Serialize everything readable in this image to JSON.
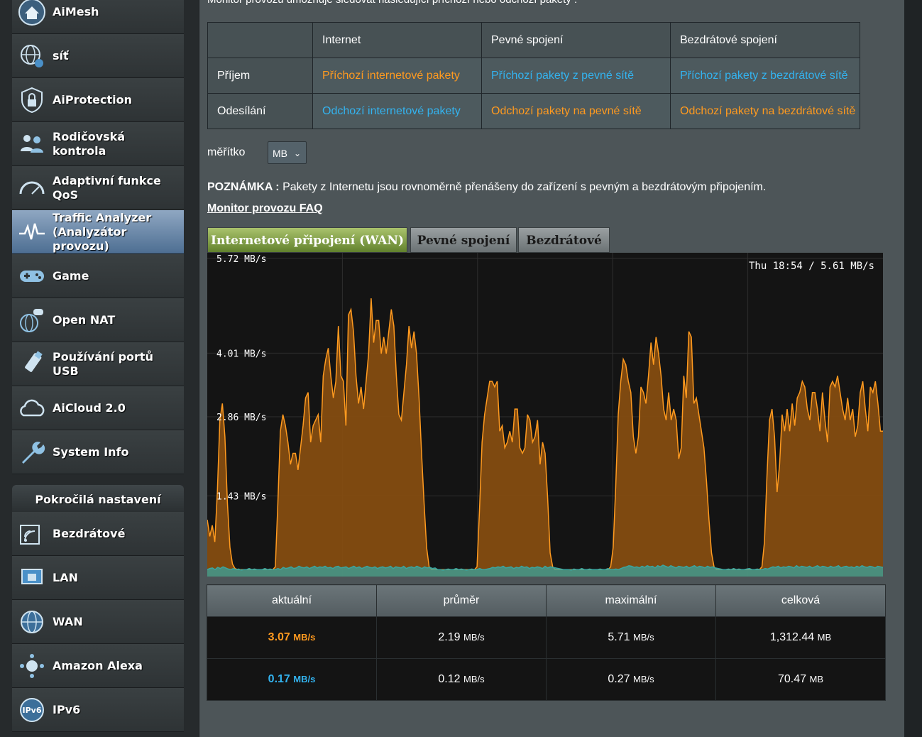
{
  "menu": {
    "items": [
      {
        "label": "AiMesh",
        "icon": "mesh-house-icon"
      },
      {
        "label": "síť",
        "icon": "network-globe-icon"
      },
      {
        "label": "AiProtection",
        "icon": "lock-shield-icon"
      },
      {
        "label": "Rodičovská kontrola",
        "icon": "parental-people-icon"
      },
      {
        "label": "Adaptivní funkce QoS",
        "icon": "speedometer-icon"
      },
      {
        "label": "Traffic Analyzer (Analyzátor provozu)",
        "icon": "pulse-icon"
      },
      {
        "label": "Game",
        "icon": "gamepad-icon"
      },
      {
        "label": "Open NAT",
        "icon": "nat-globe-icon"
      },
      {
        "label": "Používání portů USB",
        "icon": "usb-icon"
      },
      {
        "label": "AiCloud 2.0",
        "icon": "cloud-icon"
      },
      {
        "label": "System Info",
        "icon": "wrench-icon"
      }
    ],
    "advanced_header": "Pokročilá nastavení",
    "advanced_items": [
      {
        "label": "Bezdrátové",
        "icon": "wireless-icon"
      },
      {
        "label": "LAN",
        "icon": "lan-icon"
      },
      {
        "label": "WAN",
        "icon": "wan-globe-icon"
      },
      {
        "label": "Amazon Alexa",
        "icon": "alexa-icon"
      },
      {
        "label": "IPv6",
        "icon": "ipv6-icon"
      }
    ]
  },
  "main": {
    "intro": "Monitor provozu umožňuje sledovat následující příchozí nebo odchozí pakety :",
    "packet_table": {
      "headers": [
        "Internet",
        "Pevné spojení",
        "Bezdrátové spojení"
      ],
      "rows": [
        {
          "label": "Příjem",
          "cells": [
            {
              "text": "Příchozí internetové pakety",
              "color": "orange"
            },
            {
              "text": "Příchozí pakety z pevné sítě",
              "color": "blue"
            },
            {
              "text": "Příchozí pakety z bezdrátové sítě",
              "color": "blue"
            }
          ]
        },
        {
          "label": "Odesílání",
          "cells": [
            {
              "text": "Odchozí internetové pakety",
              "color": "blue"
            },
            {
              "text": "Odchozí pakety na pevné sítě",
              "color": "orange"
            },
            {
              "text": "Odchozí pakety na bezdrátové sítě",
              "color": "orange"
            }
          ]
        }
      ]
    },
    "scale_label": "měřítko",
    "scale_value": "MB",
    "note_label": "POZNÁMKA :",
    "note_text": " Pakety z Internetu jsou rovnoměrně přenášeny do zařízení s pevným a bezdrátovým připojením.",
    "faq_link": "Monitor provozu FAQ",
    "tabs": [
      "Internetové připojení (WAN)",
      "Pevné spojení",
      "Bezdrátové"
    ],
    "stats": {
      "headers": [
        "aktuální",
        "průměr",
        "maximální",
        "celková"
      ],
      "rows": [
        {
          "values": [
            "3.07",
            "2.19",
            "5.71",
            "1,312.44"
          ],
          "units": [
            "MB/s",
            "MB/s",
            "MB/s",
            "MB"
          ]
        },
        {
          "values": [
            "0.17",
            "0.12",
            "0.27",
            "70.47"
          ],
          "units": [
            "MB/s",
            "MB/s",
            "MB/s",
            "MB"
          ]
        }
      ]
    }
  },
  "chart_data": {
    "type": "area",
    "tick_labels": [
      "5.72 MB/s",
      "4.01 MB/s",
      "2.86 MB/s",
      "1.43 MB/s"
    ],
    "tick_values": [
      5.72,
      4.01,
      2.86,
      1.43
    ],
    "ylim": [
      0,
      5.72
    ],
    "status_text": "Thu 18:54 / 5.61 MB/s",
    "colors": {
      "rx": "#ff9a1f",
      "rx_fill": "#8a4f10",
      "tx": "#3aa6a0",
      "grid": "#2e2e2e"
    },
    "series": [
      {
        "values": [
          1.0,
          0.7,
          0.9,
          0.6,
          1.5,
          2.8,
          3.1,
          2.5,
          1.3,
          0.5,
          0.2,
          0.12,
          0.1,
          0.1,
          0.1,
          0.1,
          0.1,
          0.1,
          0.1,
          0.1,
          0.1,
          0.1,
          0.1,
          0.1,
          0.1,
          0.1,
          0.1,
          0.15,
          1.3,
          2.6,
          2.9,
          2.7,
          2.4,
          2.0,
          2.2,
          2.2,
          1.9,
          2.3,
          2.7,
          3.2,
          3.3,
          2.4,
          2.7,
          2.8,
          2.9,
          2.4,
          3.6,
          3.9,
          4.1,
          3.6,
          3.2,
          3.5,
          4.5,
          3.6,
          3.5,
          2.7,
          4.7,
          4.8,
          4.4,
          3.6,
          3.1,
          3.4,
          3.0,
          3.5,
          4.0,
          5.0,
          4.2,
          4.6,
          4.6,
          4.0,
          4.3,
          4.0,
          4.4,
          4.8,
          4.5,
          3.6,
          2.9,
          2.8,
          3.3,
          3.8,
          4.5,
          4.1,
          4.4,
          4.0,
          3.2,
          2.2,
          1.3,
          0.5,
          0.15,
          0.1,
          0.1,
          0.1,
          0.1,
          0.1,
          0.1,
          0.1,
          0.1,
          0.1,
          0.1,
          0.1,
          0.1,
          0.1,
          0.1,
          0.1,
          0.1,
          0.1,
          0.1,
          0.15,
          1.2,
          2.4,
          2.9,
          3.2,
          3.5,
          3.5,
          3.4,
          3.5,
          2.6,
          2.7,
          2.3,
          2.4,
          2.6,
          2.4,
          3.0,
          3.0,
          2.3,
          2.2,
          2.3,
          2.9,
          2.8,
          2.4,
          2.5,
          2.8,
          2.0,
          2.4,
          2.2,
          1.4,
          0.4,
          0.15,
          0.1,
          0.1,
          0.1,
          0.1,
          0.1,
          0.1,
          0.1,
          0.1,
          0.1,
          0.1,
          0.1,
          0.1,
          0.1,
          0.1,
          0.1,
          0.1,
          0.1,
          0.1,
          0.1,
          0.1,
          0.1,
          0.1,
          0.15,
          0.5,
          1.6,
          2.9,
          3.5,
          3.9,
          3.8,
          3.5,
          3.3,
          2.5,
          2.2,
          2.5,
          3.4,
          3.3,
          3.1,
          3.6,
          4.2,
          3.8,
          4.3,
          4.0,
          3.6,
          3.0,
          2.8,
          3.3,
          2.8,
          3.0,
          2.8,
          2.1,
          2.3,
          3.6,
          3.2,
          4.4,
          4.3,
          3.1,
          3.2,
          2.9,
          2.6,
          2.3,
          1.7,
          1.0,
          0.4,
          0.15,
          0.1,
          0.1,
          0.1,
          0.1,
          0.1,
          0.1,
          0.1,
          0.1,
          0.1,
          0.1,
          0.1,
          0.1,
          0.1,
          0.1,
          0.1,
          0.1,
          0.1,
          0.1,
          0.15,
          0.6,
          1.8,
          2.8,
          3.0,
          2.5,
          1.5,
          2.0,
          2.9,
          2.6,
          3.0,
          2.6,
          3.1,
          2.7,
          3.2,
          3.3,
          3.5,
          3.4,
          3.0,
          2.8,
          3.3,
          3.3,
          3.0,
          2.6,
          3.3,
          2.8,
          2.4,
          3.4,
          3.5,
          3.4,
          3.6,
          3.3,
          3.0,
          2.8,
          3.2,
          2.8,
          3.0,
          2.5,
          2.7,
          3.3,
          3.5,
          3.0,
          2.6,
          3.4,
          3.3,
          3.5,
          3.1,
          2.6,
          2.6
        ]
      },
      {
        "values": [
          0.1,
          0.12,
          0.13,
          0.1,
          0.14,
          0.12,
          0.15,
          0.13,
          0.11,
          0.1,
          0.12,
          0.1,
          0.11,
          0.09,
          0.1,
          0.1,
          0.12,
          0.1,
          0.11,
          0.1,
          0.1,
          0.1,
          0.12,
          0.1,
          0.11,
          0.1,
          0.1,
          0.12,
          0.1,
          0.14,
          0.12,
          0.13,
          0.15,
          0.12,
          0.13,
          0.16,
          0.14,
          0.13,
          0.15,
          0.12,
          0.14,
          0.16,
          0.13,
          0.15,
          0.14,
          0.16,
          0.13,
          0.14,
          0.12,
          0.15,
          0.16,
          0.13,
          0.14,
          0.15,
          0.12,
          0.14,
          0.16,
          0.13,
          0.15,
          0.12,
          0.14,
          0.16,
          0.14,
          0.13,
          0.15,
          0.12,
          0.14,
          0.15,
          0.13,
          0.14,
          0.16,
          0.12,
          0.15,
          0.14,
          0.13,
          0.16,
          0.12,
          0.14,
          0.15,
          0.13,
          0.16,
          0.14,
          0.12,
          0.15,
          0.13,
          0.14,
          0.12,
          0.13,
          0.1,
          0.1,
          0.09,
          0.1,
          0.11,
          0.1,
          0.1,
          0.12,
          0.1,
          0.11,
          0.1,
          0.09,
          0.1,
          0.11,
          0.1,
          0.1,
          0.12,
          0.1,
          0.1,
          0.11,
          0.12,
          0.14,
          0.13,
          0.15,
          0.14,
          0.16,
          0.13,
          0.14,
          0.15,
          0.12,
          0.14,
          0.13,
          0.16,
          0.14,
          0.15,
          0.12,
          0.14,
          0.13,
          0.15,
          0.14,
          0.12,
          0.16,
          0.13,
          0.15,
          0.14,
          0.13,
          0.12,
          0.11,
          0.1,
          0.1,
          0.1,
          0.09,
          0.11,
          0.1,
          0.1,
          0.12,
          0.1,
          0.1,
          0.11,
          0.1,
          0.1,
          0.1,
          0.11,
          0.1,
          0.1,
          0.12,
          0.1,
          0.1,
          0.11,
          0.1,
          0.12,
          0.14,
          0.15,
          0.17,
          0.16,
          0.14,
          0.15,
          0.13,
          0.16,
          0.14,
          0.17,
          0.15,
          0.16,
          0.13,
          0.17,
          0.15,
          0.18,
          0.16,
          0.14,
          0.17,
          0.15,
          0.13,
          0.16,
          0.15,
          0.14,
          0.16,
          0.13,
          0.15,
          0.17,
          0.14,
          0.16,
          0.15,
          0.13,
          0.16,
          0.14,
          0.15,
          0.13,
          0.12,
          0.11,
          0.1,
          0.1,
          0.11,
          0.1,
          0.12,
          0.1,
          0.11,
          0.1,
          0.1,
          0.11,
          0.12,
          0.1,
          0.1,
          0.11,
          0.1,
          0.1,
          0.12,
          0.11,
          0.13,
          0.15,
          0.14,
          0.16,
          0.13,
          0.15,
          0.14,
          0.16,
          0.15,
          0.13,
          0.17,
          0.14,
          0.16,
          0.15,
          0.14,
          0.16,
          0.13,
          0.15,
          0.17,
          0.14,
          0.16,
          0.15,
          0.13,
          0.16,
          0.14,
          0.15,
          0.17,
          0.13,
          0.15,
          0.16,
          0.14,
          0.15,
          0.13,
          0.16,
          0.14,
          0.17,
          0.15,
          0.14,
          0.16,
          0.15,
          0.13,
          0.16,
          0.15,
          0.14
        ]
      }
    ]
  }
}
